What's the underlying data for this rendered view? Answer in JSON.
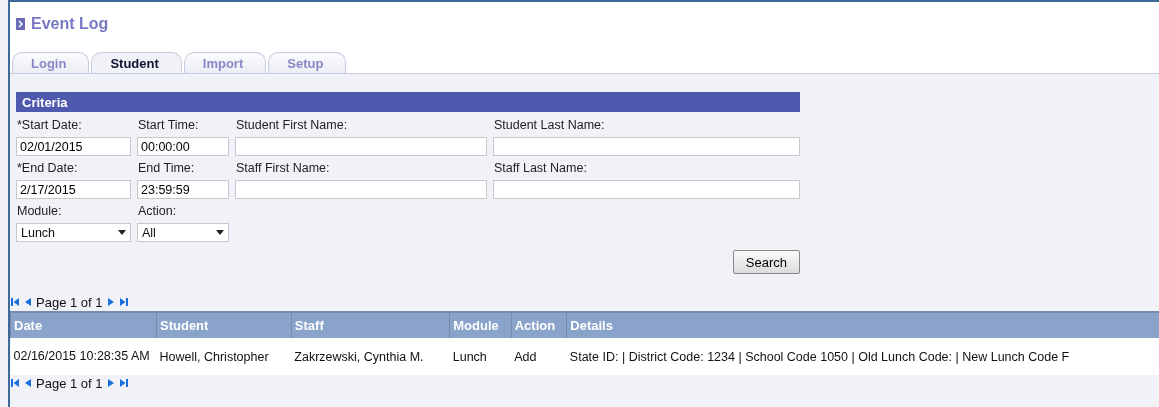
{
  "window": {
    "title": "Event Log"
  },
  "tabs": [
    {
      "label": "Login",
      "selected": false
    },
    {
      "label": "Student",
      "selected": true
    },
    {
      "label": "Import",
      "selected": false
    },
    {
      "label": "Setup",
      "selected": false
    }
  ],
  "criteria": {
    "title": "Criteria",
    "fields": [
      {
        "label": "*Start Date:",
        "kind": "text",
        "value": "02/01/2015"
      },
      {
        "label": "Start Time:",
        "kind": "text",
        "value": "00:00:00"
      },
      {
        "label": "Student First Name:",
        "kind": "text"
      },
      {
        "label": "Student Last Name:",
        "kind": "text"
      },
      {
        "label": "*End Date:",
        "kind": "text",
        "value": "2/17/2015"
      },
      {
        "label": "End Time:",
        "kind": "text",
        "value": "23:59:59"
      },
      {
        "label": "Staff First Name:",
        "kind": "text"
      },
      {
        "label": "Staff Last Name:",
        "kind": "text"
      },
      {
        "label": "Module:",
        "kind": "select",
        "value": "Lunch"
      },
      {
        "label": "Action:",
        "kind": "select",
        "value": "All"
      }
    ],
    "search_button": "Search"
  },
  "pager_top": "Page 1 of 1",
  "table": {
    "columns": [
      "Date",
      "Student",
      "Staff",
      "Module",
      "Action",
      "Details"
    ],
    "rows": [
      [
        "02/16/2015 10:28:35 AM",
        "Howell, Christopher",
        "Zakrzewski, Cynthia M.",
        "Lunch",
        "Add",
        "State ID: | District Code: 1234 | School Code 1050 | Old Lunch Code: | New Lunch Code F"
      ]
    ]
  },
  "pager_bottom": "Page 1 of 1"
}
